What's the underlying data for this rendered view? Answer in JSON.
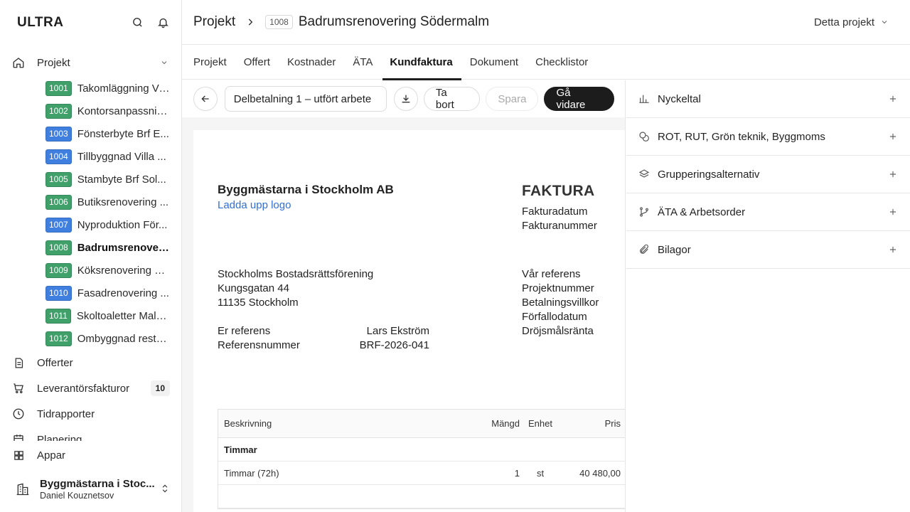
{
  "brand": "ULTRA",
  "sidebar": {
    "projects_label": "Projekt",
    "projects": [
      {
        "num": "1001",
        "name": "Takomläggning Vi...",
        "color": "#3fa06a"
      },
      {
        "num": "1002",
        "name": "Kontorsanpassnin...",
        "color": "#3fa06a"
      },
      {
        "num": "1003",
        "name": "Fönsterbyte Brf E...",
        "color": "#3f7fe0"
      },
      {
        "num": "1004",
        "name": "Tillbyggnad Villa ...",
        "color": "#3f7fe0"
      },
      {
        "num": "1005",
        "name": "Stambyte Brf Sol...",
        "color": "#3fa06a"
      },
      {
        "num": "1006",
        "name": "Butiksrenovering ...",
        "color": "#3fa06a"
      },
      {
        "num": "1007",
        "name": "Nyproduktion För...",
        "color": "#3f7fe0"
      },
      {
        "num": "1008",
        "name": "Badrumsrenoveri...",
        "color": "#3fa06a",
        "active": true
      },
      {
        "num": "1009",
        "name": "Köksrenovering U...",
        "color": "#3fa06a"
      },
      {
        "num": "1010",
        "name": "Fasadrenovering ...",
        "color": "#3f7fe0"
      },
      {
        "num": "1011",
        "name": "Skoltoaletter Malmö",
        "color": "#3fa06a"
      },
      {
        "num": "1012",
        "name": "Ombyggnad resta...",
        "color": "#3fa06a"
      }
    ],
    "offerter": "Offerter",
    "leverantorsfakturor": "Leverantörsfakturor",
    "leverantorsfakturor_count": "10",
    "tidrapporter": "Tidrapporter",
    "planering_partial": "Planering",
    "appar": "Appar",
    "account": {
      "org": "Byggmästarna i Stoc...",
      "user": "Daniel Kouznetsov"
    }
  },
  "header": {
    "root": "Projekt",
    "project_num": "1008",
    "project_title": "Badrumsrenovering Södermalm",
    "scope": "Detta projekt"
  },
  "tabs": [
    "Projekt",
    "Offert",
    "Kostnader",
    "ÄTA",
    "Kundfaktura",
    "Dokument",
    "Checklistor"
  ],
  "active_tab": "Kundfaktura",
  "toolbar": {
    "invoice_name": "Delbetalning 1 – utfört arbete",
    "delete": "Ta bort",
    "save": "Spara",
    "next": "Gå vidare"
  },
  "invoice": {
    "company": "Byggmästarna i Stockholm AB",
    "upload_logo": "Ladda upp logo",
    "title": "FAKTURA",
    "meta": [
      "Fakturadatum",
      "Fakturanummer"
    ],
    "customer": [
      "Stockholms Bostadsrättsförening",
      "Kungsgatan 44",
      "11135 Stockholm"
    ],
    "refs": [
      "Vår referens",
      "Projektnummer",
      "Betalningsvillkor",
      "Förfallodatum",
      "Dröjsmålsränta"
    ],
    "er_referens_label": "Er referens",
    "er_referens_value": "Lars Ekström",
    "referensnummer_label": "Referensnummer",
    "referensnummer_value": "BRF-2026-041",
    "table": {
      "headers": {
        "desc": "Beskrivning",
        "qty": "Mängd",
        "unit": "Enhet",
        "price": "Pris"
      },
      "group": "Timmar",
      "row": {
        "desc": "Timmar (72h)",
        "qty": "1",
        "unit": "st",
        "price": "40 480,00"
      }
    }
  },
  "rpanel": [
    {
      "label": "Nyckeltal",
      "icon": "chart-icon"
    },
    {
      "label": "ROT, RUT, Grön teknik, Byggmoms",
      "icon": "coins-icon"
    },
    {
      "label": "Grupperingsalternativ",
      "icon": "layers-icon"
    },
    {
      "label": "ÄTA & Arbetsorder",
      "icon": "branch-icon"
    },
    {
      "label": "Bilagor",
      "icon": "paperclip-icon"
    }
  ]
}
